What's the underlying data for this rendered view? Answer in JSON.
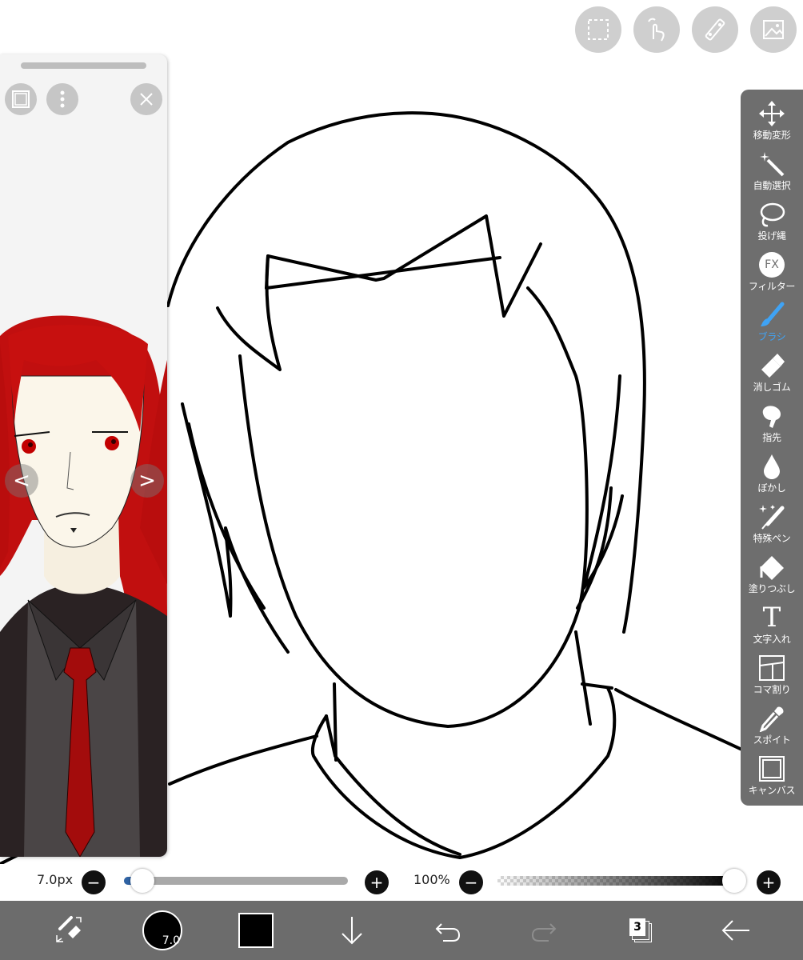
{
  "top_buttons": [
    {
      "name": "selection-icon"
    },
    {
      "name": "gesture-icon"
    },
    {
      "name": "ruler-icon"
    },
    {
      "name": "material-icon"
    }
  ],
  "reference_window": {
    "prev_label": "<",
    "next_label": ">"
  },
  "tools": [
    {
      "label": "移動変形",
      "icon": "move-transform-icon"
    },
    {
      "label": "自動選択",
      "icon": "magic-wand-icon"
    },
    {
      "label": "投げ縄",
      "icon": "lasso-icon"
    },
    {
      "label": "フィルター",
      "icon": "fx-filter-icon",
      "badge": "FX"
    },
    {
      "label": "ブラシ",
      "icon": "brush-icon",
      "active": true
    },
    {
      "label": "消しゴム",
      "icon": "eraser-icon"
    },
    {
      "label": "指先",
      "icon": "smudge-icon"
    },
    {
      "label": "ぼかし",
      "icon": "blur-drop-icon"
    },
    {
      "label": "特殊ペン",
      "icon": "special-pen-icon"
    },
    {
      "label": "塗りつぶし",
      "icon": "fill-bucket-icon"
    },
    {
      "label": "文字入れ",
      "icon": "text-icon",
      "badge": "T"
    },
    {
      "label": "コマ割り",
      "icon": "frame-divider-icon"
    },
    {
      "label": "スポイト",
      "icon": "eyedropper-icon"
    },
    {
      "label": "キャンバス",
      "icon": "canvas-icon"
    }
  ],
  "brush_size": {
    "label": "7.0px",
    "value_fraction": 0.08,
    "minus": "−",
    "plus": "+"
  },
  "opacity": {
    "label": "100%",
    "value_fraction": 1.0,
    "minus": "−",
    "plus": "+"
  },
  "bottom_bar": {
    "brush_size_badge": "7.0",
    "current_color": "#000000",
    "layer_count": "3"
  },
  "colors": {
    "toolbar_bg": "#6e6e6e",
    "active_tool": "#3fa3f5",
    "slider_fill": "#2f63a4"
  }
}
